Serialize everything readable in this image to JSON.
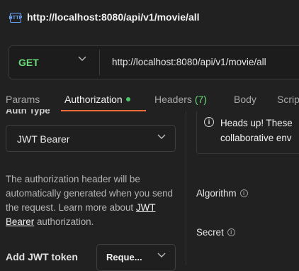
{
  "titlebar": {
    "icon_text": "HTTP",
    "title": "http://localhost:8080/api/v1/movie/all"
  },
  "request": {
    "method": "GET",
    "url": "http://localhost:8080/api/v1/movie/all"
  },
  "tabs": [
    {
      "label": "Params"
    },
    {
      "label": "Authorization",
      "active": true
    },
    {
      "label": "Headers",
      "count": "(7)"
    },
    {
      "label": "Body"
    },
    {
      "label": "Scrip"
    }
  ],
  "auth": {
    "type_label": "Auth Type",
    "type_value": "JWT Bearer",
    "info_text": "The authorization header will be automatically generated when you send the request. Learn more about",
    "info_link": "JWT Bearer",
    "info_suffix": "authorization.",
    "add_token_label": "Add JWT token",
    "token_select_value": "Reque..."
  },
  "notice": {
    "icon": "i",
    "line1": "Heads up! These",
    "line2": "collaborative env"
  },
  "fields": {
    "algorithm_label": "Algorithm",
    "secret_label": "Secret",
    "info_glyph": "i"
  },
  "colors": {
    "accent": "#ff6c37",
    "method_get": "#6bdd7b",
    "status_dot": "#4bc56a",
    "background": "#212121"
  }
}
